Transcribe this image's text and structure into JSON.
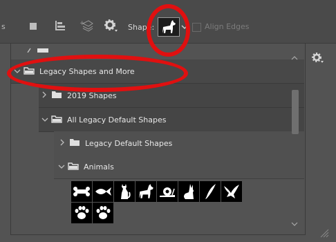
{
  "toolbar": {
    "cut_text": "s",
    "shape_label": "Shape:",
    "align_edges_label": "Align Edges",
    "icons": [
      "stop-icon",
      "align-icon",
      "path-arrangement-icon",
      "gear-icon",
      "dog-shape-icon",
      "chevron-down-icon"
    ]
  },
  "panel": {
    "rows": [
      {
        "label": "Legacy Shapes and More",
        "expanded": true
      },
      {
        "label": "2019 Shapes",
        "expanded": false
      },
      {
        "label": "All Legacy Default Shapes",
        "expanded": true
      },
      {
        "label": "Legacy Default Shapes",
        "expanded": false
      },
      {
        "label": "Animals",
        "expanded": true
      }
    ],
    "shapes": [
      "bone",
      "fish",
      "cat",
      "dog",
      "snail",
      "rabbit",
      "bird-feather",
      "bird-flying",
      "paw-print",
      "paw-print-2"
    ]
  },
  "colors": {
    "highlight_ring": "#e01010",
    "bg": "#535353"
  }
}
